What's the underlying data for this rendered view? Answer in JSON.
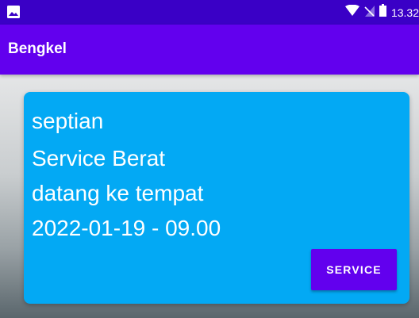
{
  "status_bar": {
    "time": "13.32",
    "icons": [
      "image-icon",
      "wifi-icon",
      "no-sim-icon",
      "battery-icon"
    ]
  },
  "app_bar": {
    "title": "Bengkel"
  },
  "booking_card": {
    "name": "septian",
    "service_type": "Service Berat",
    "service_location": "datang ke tempat",
    "schedule": "2022-01-19 - 09.00",
    "action_label": "SERVICE"
  },
  "colors": {
    "status_bar": "#3a00c6",
    "app_bar": "#6200ee",
    "card": "#03a9f4",
    "button": "#6200ee",
    "text": "#ffffff"
  }
}
